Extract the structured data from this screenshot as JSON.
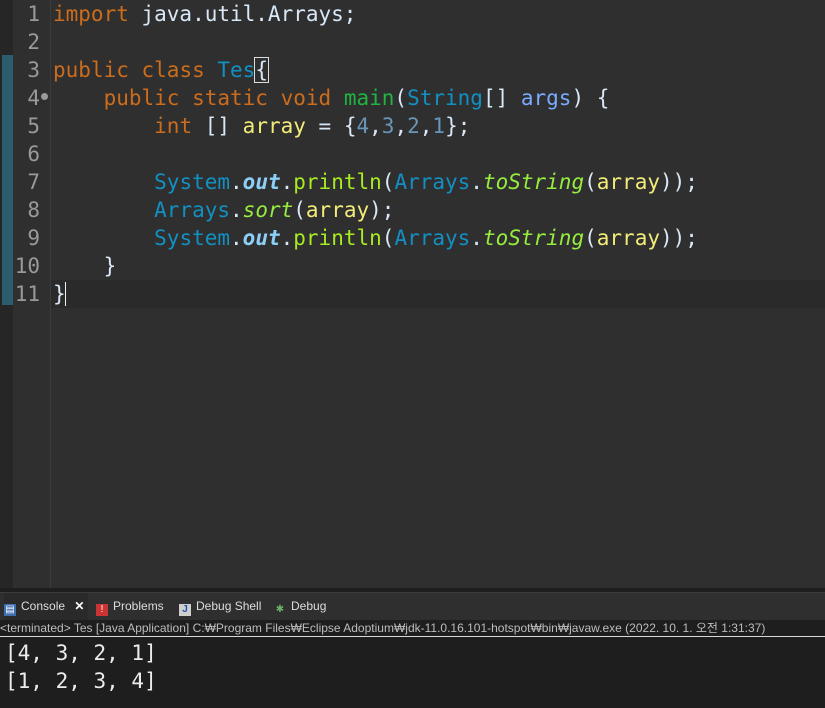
{
  "editor": {
    "line_numbers": [
      "1",
      "2",
      "3",
      "4",
      "5",
      "6",
      "7",
      "8",
      "9",
      "10",
      "11"
    ],
    "tokens": {
      "l1_kw": "import",
      "l1_rest": " java.util.Arrays;",
      "l3_kw1": "public",
      "l3_kw2": "class",
      "l3_cls": "Tes",
      "l3_brace": "{",
      "l4_kw1": "public",
      "l4_kw2": "static",
      "l4_kw3": "void",
      "l4_meth": "main",
      "l4_open": "(",
      "l4_type": "String",
      "l4_arr": "[] ",
      "l4_param": "args",
      "l4_close": ") {",
      "l5_kw": "int",
      "l5_arr": " [] ",
      "l5_var": "array",
      "l5_eq": " = {",
      "l5_n1": "4",
      "l5_n2": "3",
      "l5_n3": "2",
      "l5_n4": "1",
      "l5_end": "};",
      "comma": ",",
      "sys": "System",
      "dot": ".",
      "out": "out",
      "println": "println",
      "paren_open": "(",
      "arrays": "Arrays",
      "toString": "toString",
      "sort": "sort",
      "array": "array",
      "close2": "));",
      "close1": ");",
      "l10": "}",
      "l11": "}"
    }
  },
  "console": {
    "tabs": [
      {
        "label": "Console",
        "icon": "console-icon"
      },
      {
        "label": "Problems",
        "icon": "problems-icon"
      },
      {
        "label": "Debug Shell",
        "icon": "debug-shell-icon"
      },
      {
        "label": "Debug",
        "icon": "debug-icon"
      }
    ],
    "status": "<terminated> Tes [Java Application] C:₩Program Files₩Eclipse Adoptium₩jdk-11.0.16.101-hotspot₩bin₩javaw.exe (2022. 10. 1. 오전 1:31:37)",
    "output": [
      "[4, 3, 2, 1]",
      "[1, 2, 3, 4]"
    ]
  }
}
